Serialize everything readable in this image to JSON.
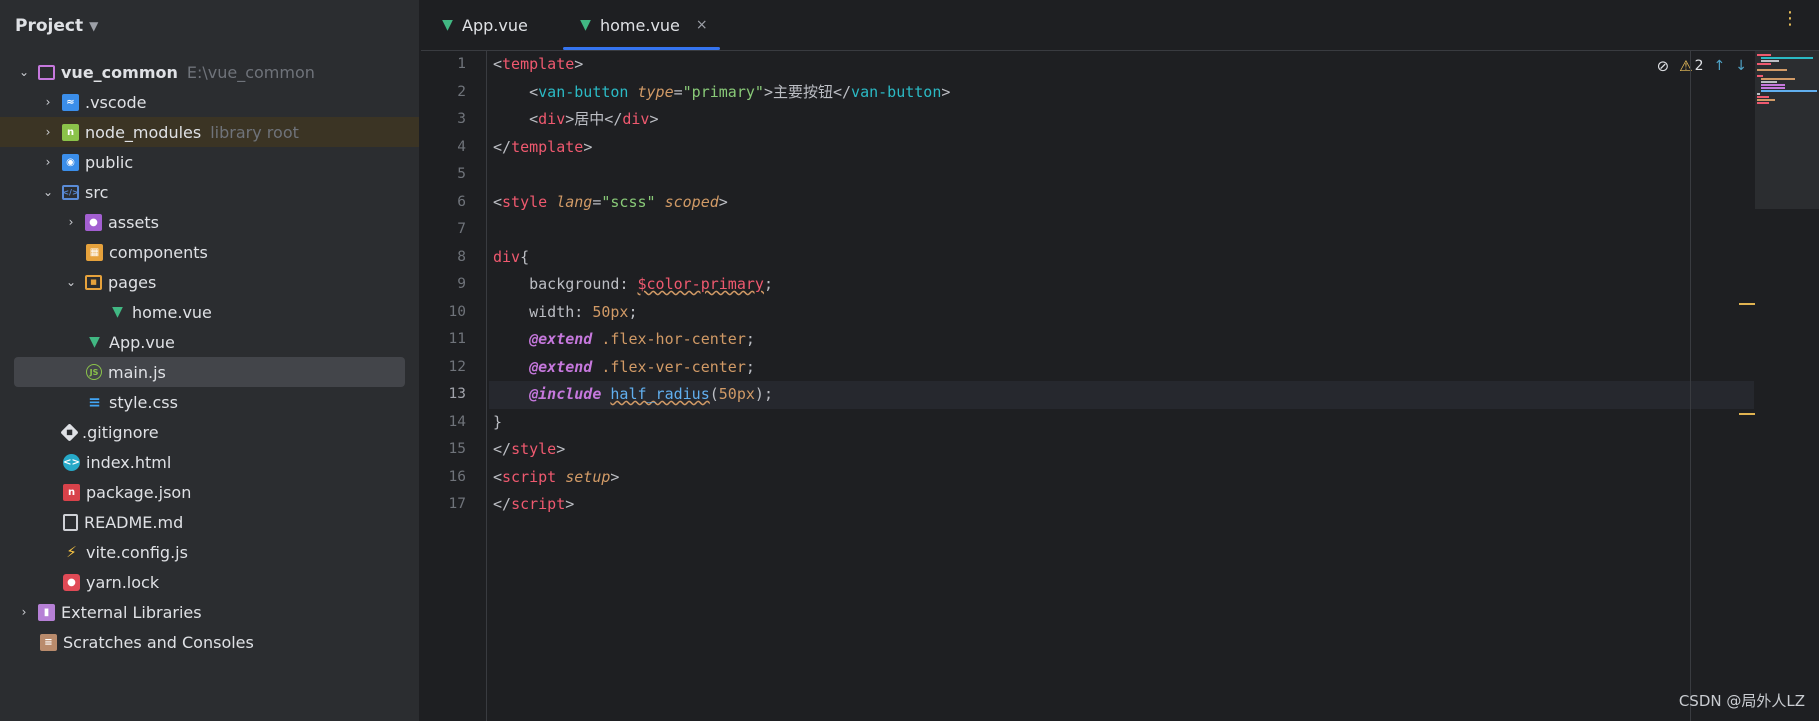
{
  "project": {
    "title": "Project"
  },
  "tree": [
    {
      "label": "vue_common",
      "hint": "E:\\vue_common"
    },
    {
      "label": ".vscode"
    },
    {
      "label": "node_modules",
      "hint": "library root"
    },
    {
      "label": "public"
    },
    {
      "label": "src"
    },
    {
      "label": "assets"
    },
    {
      "label": "components"
    },
    {
      "label": "pages"
    },
    {
      "label": "home.vue"
    },
    {
      "label": "App.vue"
    },
    {
      "label": "main.js"
    },
    {
      "label": "style.css"
    },
    {
      "label": ".gitignore"
    },
    {
      "label": "index.html"
    },
    {
      "label": "package.json"
    },
    {
      "label": "README.md"
    },
    {
      "label": "vite.config.js"
    },
    {
      "label": "yarn.lock"
    },
    {
      "label": "External Libraries"
    },
    {
      "label": "Scratches and Consoles"
    }
  ],
  "tabs": [
    {
      "label": "App.vue"
    },
    {
      "label": "home.vue",
      "close": "×"
    }
  ],
  "inspection": {
    "warnings": "2"
  },
  "gutter": [
    "1",
    "2",
    "3",
    "4",
    "5",
    "6",
    "7",
    "8",
    "9",
    "10",
    "11",
    "12",
    "13",
    "14",
    "15",
    "16",
    "17"
  ],
  "code": [
    {
      "a": "<",
      "b": "template",
      "c": ">"
    },
    {
      "indent": "    ",
      "lt": "<",
      "tag": "van-button",
      "sp": " ",
      "attr": "type",
      "eq": "=",
      "str": "\"primary\"",
      "gt": ">",
      "text": "主要按钮",
      "lt2": "</",
      "tag2": "van-button",
      "gt2": ">"
    },
    {
      "indent": "    ",
      "lt": "<",
      "tag": "div",
      "gt": ">",
      "text": "居中",
      "lt2": "</",
      "tag2": "div",
      "gt2": ">"
    },
    {
      "a": "</",
      "b": "template",
      "c": ">"
    },
    {},
    {
      "lt": "<",
      "tag": "style",
      "sp": " ",
      "attr": "lang",
      "eq": "=",
      "str": "\"scss\"",
      "sp2": " ",
      "attr2": "scoped",
      "gt": ">"
    },
    {},
    {
      "sel": "div",
      "brace": "{"
    },
    {
      "indent": "    ",
      "prop": "background",
      "colon": ": ",
      "var": "$color-primary",
      "semi": ";"
    },
    {
      "indent": "    ",
      "prop": "width",
      "colon": ": ",
      "num": "50px",
      "semi": ";"
    },
    {
      "indent": "    ",
      "at": "@extend",
      "sp": " ",
      "cls": ".flex-hor-center",
      "semi": ";"
    },
    {
      "indent": "    ",
      "at": "@extend",
      "sp": " ",
      "cls": ".flex-ver-center",
      "semi": ";"
    },
    {
      "indent": "    ",
      "at": "@include",
      "sp": " ",
      "fn": "half_radius",
      "open": "(",
      "num": "50px",
      "close": ")",
      "semi": ";"
    },
    {
      "brace": "}"
    },
    {
      "a": "</",
      "b": "style",
      "c": ">"
    },
    {
      "lt": "<",
      "tag": "script",
      "sp": " ",
      "attr": "setup",
      "gt": ">"
    },
    {
      "a": "</",
      "b": "script",
      "c": ">"
    }
  ],
  "watermark": "CSDN @局外人LZ"
}
